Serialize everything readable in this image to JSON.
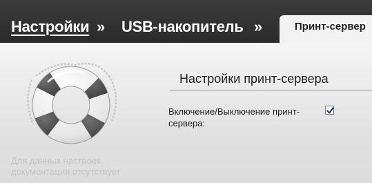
{
  "breadcrumb": {
    "home": "Настройки",
    "separator": "»",
    "usb": "USB-накопитель",
    "current_tab": "Принт-сервер"
  },
  "help": {
    "icon": "lifebuoy-icon",
    "note_line1": "Для данных настроек",
    "note_line2": "документация отсутствует"
  },
  "section": {
    "title": "Настройки принт-сервера",
    "field_label_line1": "Включение/Выключение принт-",
    "field_label_line2": "сервера:",
    "enabled": true
  },
  "colors": {
    "header_bg": "#333333",
    "content_bg": "#ebebeb",
    "note_text": "#c4c4c4",
    "checkbox_check": "#1a237e"
  }
}
